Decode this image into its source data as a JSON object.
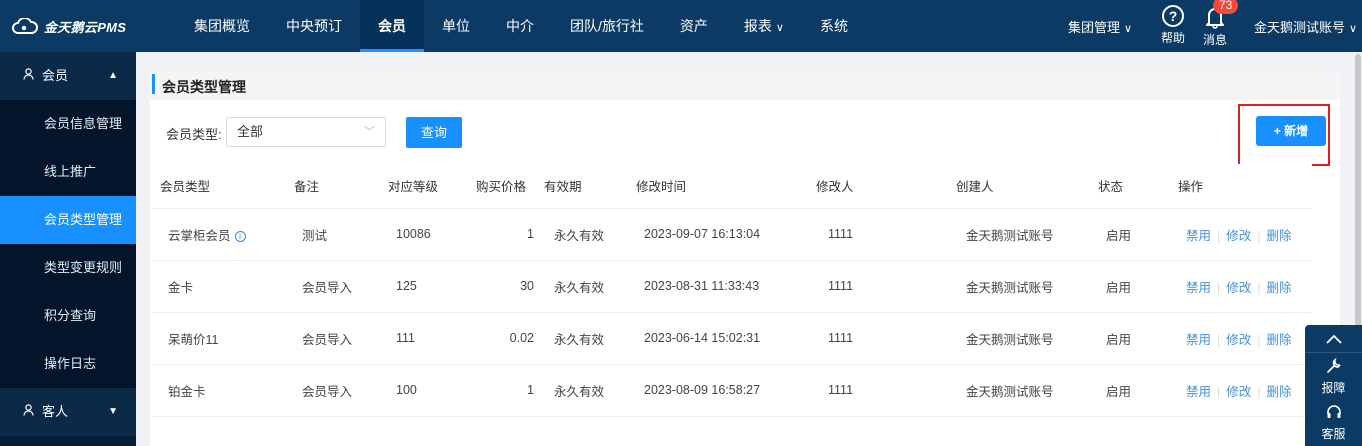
{
  "app": {
    "logo_text": "金天鹅云PMS"
  },
  "nav": {
    "items": [
      {
        "label": "集团概览"
      },
      {
        "label": "中央预订"
      },
      {
        "label": "会员"
      },
      {
        "label": "单位"
      },
      {
        "label": "中介"
      },
      {
        "label": "团队/旅行社"
      },
      {
        "label": "资产"
      },
      {
        "label": "报表"
      },
      {
        "label": "系统"
      }
    ],
    "caret": "∨"
  },
  "header_right": {
    "group_mgmt": "集团管理",
    "help_label": "帮助",
    "help_glyph": "?",
    "message_label": "消息",
    "message_count": "73",
    "account": "金天鹅测试账号"
  },
  "sidebar": {
    "group_member": "会员",
    "items": [
      {
        "label": "会员信息管理"
      },
      {
        "label": "线上推广"
      },
      {
        "label": "会员类型管理"
      },
      {
        "label": "类型变更规则"
      },
      {
        "label": "积分查询"
      },
      {
        "label": "操作日志"
      }
    ],
    "group_guest": "客人"
  },
  "panel": {
    "title": "会员类型管理",
    "filter_label": "会员类型:",
    "filter_value": "全部",
    "query_button": "查询",
    "add_button": "+ 新增"
  },
  "table": {
    "headers": [
      "会员类型",
      "备注",
      "对应等级",
      "购买价格",
      "有效期",
      "修改时间",
      "修改人",
      "创建人",
      "状态",
      "操作"
    ],
    "actions": {
      "disable": "禁用",
      "edit": "修改",
      "delete": "删除"
    },
    "rows": [
      {
        "type": "云掌柜会员",
        "note": "测试",
        "level": "10086",
        "price": "1",
        "validity": "永久有效",
        "modified": "2023-09-07 16:13:04",
        "modifier": "1111",
        "creator": "金天鹅测试账号",
        "status": "启用"
      },
      {
        "type": "金卡",
        "note": "会员导入",
        "level": "125",
        "price": "30",
        "validity": "永久有效",
        "modified": "2023-08-31 11:33:43",
        "modifier": "1111",
        "creator": "金天鹅测试账号",
        "status": "启用"
      },
      {
        "type": "呆萌价11",
        "note": "会员导入",
        "level": "111",
        "price": "0.02",
        "validity": "永久有效",
        "modified": "2023-06-14 15:02:31",
        "modifier": "1111",
        "creator": "金天鹅测试账号",
        "status": "启用"
      },
      {
        "type": "铂金卡",
        "note": "会员导入",
        "level": "100",
        "price": "1",
        "validity": "永久有效",
        "modified": "2023-08-09 16:58:27",
        "modifier": "1111",
        "creator": "金天鹅测试账号",
        "status": "启用"
      }
    ]
  },
  "float_tools": {
    "repair": "报障",
    "service": "客服"
  },
  "colors": {
    "primary": "#1890ff",
    "header": "#0b3a64",
    "highlight": "#e02020"
  }
}
